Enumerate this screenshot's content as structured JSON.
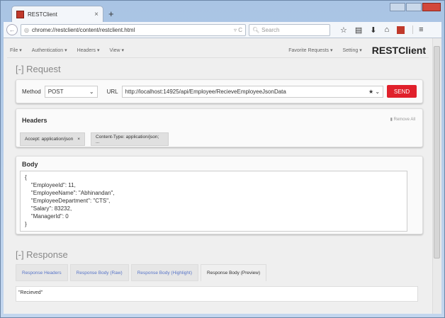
{
  "browser": {
    "tab_title": "RESTClient",
    "new_tab": "+",
    "close": "×",
    "url": "chrome://restclient/content/restclient.html",
    "search_placeholder": "Search"
  },
  "menu": {
    "items": [
      "File",
      "Authentication",
      "Headers",
      "View"
    ],
    "right": [
      "Favorite Requests",
      "Setting"
    ],
    "brand": "RESTClient"
  },
  "request": {
    "title": "[-] Request",
    "method_label": "Method",
    "method": "POST",
    "url_label": "URL",
    "url": "http://localhost:14925/api/Employee/RecieveEmployeeJsonData",
    "send": "SEND"
  },
  "headers": {
    "title": "Headers",
    "remove_all": "Remove All",
    "chips": [
      "Accept: application/json",
      "Content-Type: application/json; ..."
    ]
  },
  "body": {
    "title": "Body",
    "content": "{\n    \"EmployeeId\": 11,\n    \"EmployeeName\": \"Abhinandan\",\n    \"EmployeeDepartment\": \"CTS\",\n    \"Salary\": 83232,\n    \"ManagerId\": 0\n}"
  },
  "response": {
    "title": "[-] Response",
    "tabs": [
      "Response Headers",
      "Response Body (Raw)",
      "Response Body (Highlight)",
      "Response Body (Preview)"
    ],
    "content": "\"Recieved\""
  },
  "colors": {
    "send": "#e0202b",
    "link": "#5875c8"
  }
}
